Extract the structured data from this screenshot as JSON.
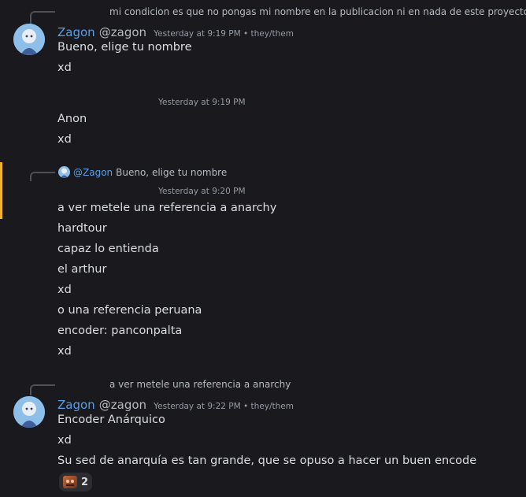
{
  "messages": {
    "reply1": {
      "text": "mi condicion es que no pongas mi nombre en la publicacion ni en nada de este proyecto"
    },
    "group1": {
      "username": "Zagon",
      "handle": "@zagon",
      "meta": "Yesterday at 9:19 PM • they/them",
      "lines": [
        "Bueno, elige tu nombre",
        "xd"
      ]
    },
    "group2": {
      "timestamp": "Yesterday at 9:19 PM",
      "lines": [
        "Anon",
        "xd"
      ]
    },
    "group3": {
      "reply_mention": "@Zagon",
      "reply_text": "Bueno, elige tu nombre",
      "timestamp": "Yesterday at 9:20 PM",
      "lines": [
        "a ver metele una referencia a anarchy",
        "hardtour",
        "capaz lo entienda",
        "el arthur",
        "xd",
        "o una referencia peruana",
        "encoder: panconpalta",
        "xd"
      ]
    },
    "group4": {
      "reply_text": "a ver metele una referencia a anarchy",
      "username": "Zagon",
      "handle": "@zagon",
      "meta": "Yesterday at 9:22 PM • they/them",
      "lines": [
        "Encoder Anárquico",
        "xd",
        "Su sed de anarquía es tan grande, que se opuso a hacer un buen encode"
      ],
      "reaction": {
        "icon": "custom-emoji-icon",
        "count": "2"
      }
    }
  },
  "colors": {
    "background": "#1a1a1e",
    "username": "#5a9ee8",
    "highlight": "#f0b232"
  }
}
